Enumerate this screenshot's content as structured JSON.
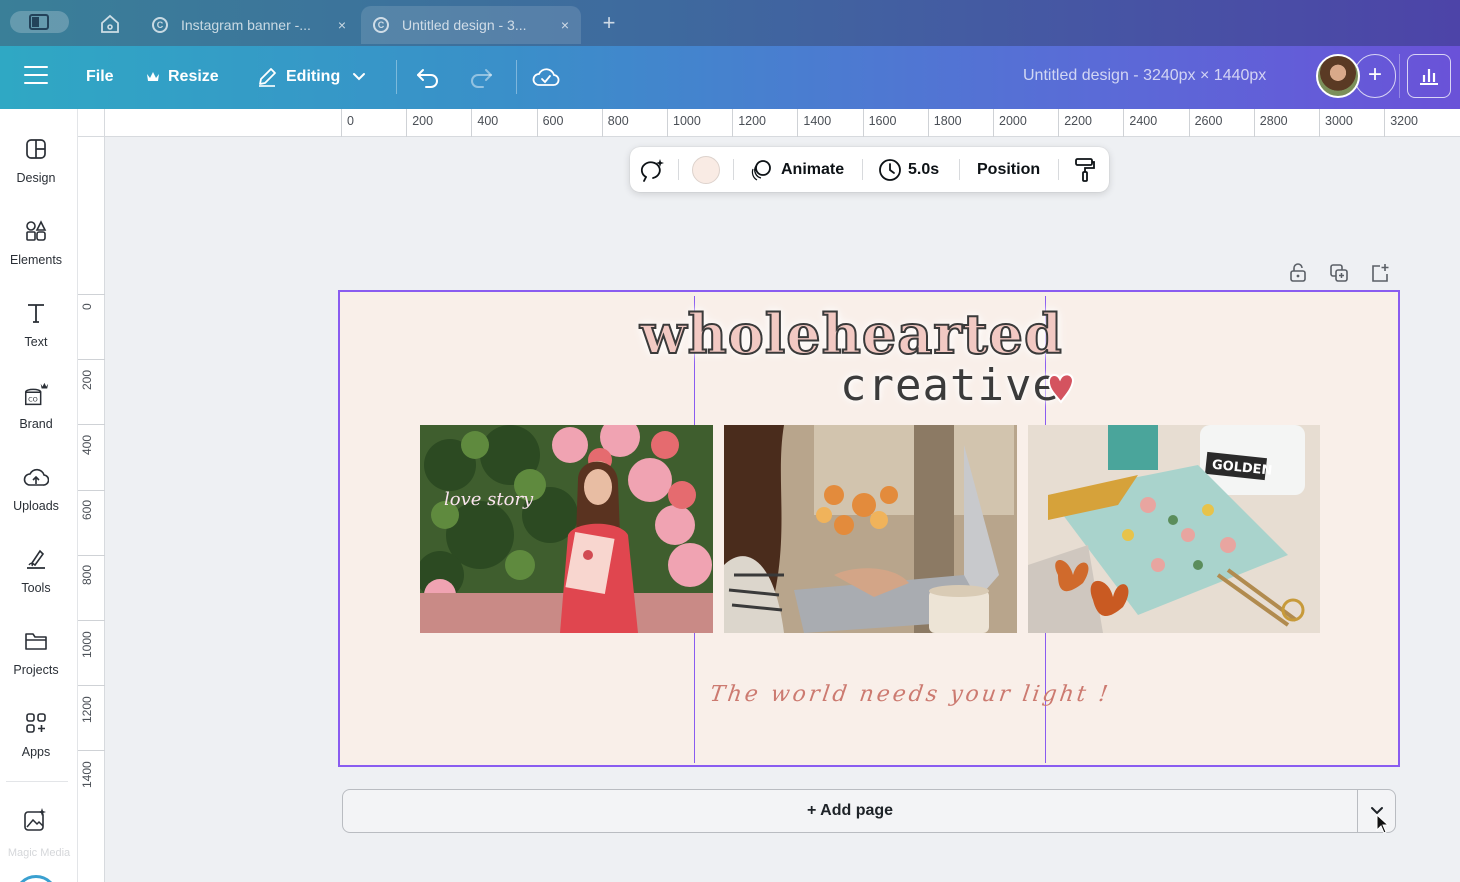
{
  "browser": {
    "tabs": [
      {
        "title": "Instagram banner -...",
        "favicon": "C",
        "active": false
      },
      {
        "title": "Untitled design - 3...",
        "favicon": "C",
        "active": true
      }
    ],
    "close_glyph": "×",
    "new_tab_glyph": "+"
  },
  "header": {
    "file_label": "File",
    "resize_label": "Resize",
    "editing_label": "Editing",
    "doc_title": "Untitled design - 3240px × 1440px",
    "add_glyph": "+"
  },
  "sidebar": {
    "items": [
      {
        "label": "Design",
        "icon": "design-icon"
      },
      {
        "label": "Elements",
        "icon": "elements-icon"
      },
      {
        "label": "Text",
        "icon": "text-icon"
      },
      {
        "label": "Brand",
        "icon": "brand-icon"
      },
      {
        "label": "Uploads",
        "icon": "uploads-icon"
      },
      {
        "label": "Tools",
        "icon": "tools-icon"
      },
      {
        "label": "Projects",
        "icon": "projects-icon"
      },
      {
        "label": "Apps",
        "icon": "apps-icon"
      }
    ],
    "faint_label": "Magic Media"
  },
  "ruler": {
    "h_labels": [
      "0",
      "200",
      "400",
      "600",
      "800",
      "1000",
      "1200",
      "1400",
      "1600",
      "1800",
      "2000",
      "2200",
      "2400",
      "2600",
      "2800",
      "3000",
      "3200"
    ],
    "v_labels": [
      "0",
      "200",
      "400",
      "600",
      "800",
      "1000",
      "1200",
      "1400"
    ]
  },
  "context_toolbar": {
    "animate_label": "Animate",
    "duration_label": "5.0s",
    "position_label": "Position",
    "swatch_color": "#f9ebe4"
  },
  "design": {
    "brand_line1": "wholehearted",
    "brand_line2": "creative",
    "tagline": "The world needs your light !",
    "jar_label": "GOLDEN",
    "neon_text": "love story",
    "background_color": "#f9efe9",
    "selection_color": "#8a5cf0"
  },
  "footer": {
    "add_page_label": "+ Add page"
  }
}
